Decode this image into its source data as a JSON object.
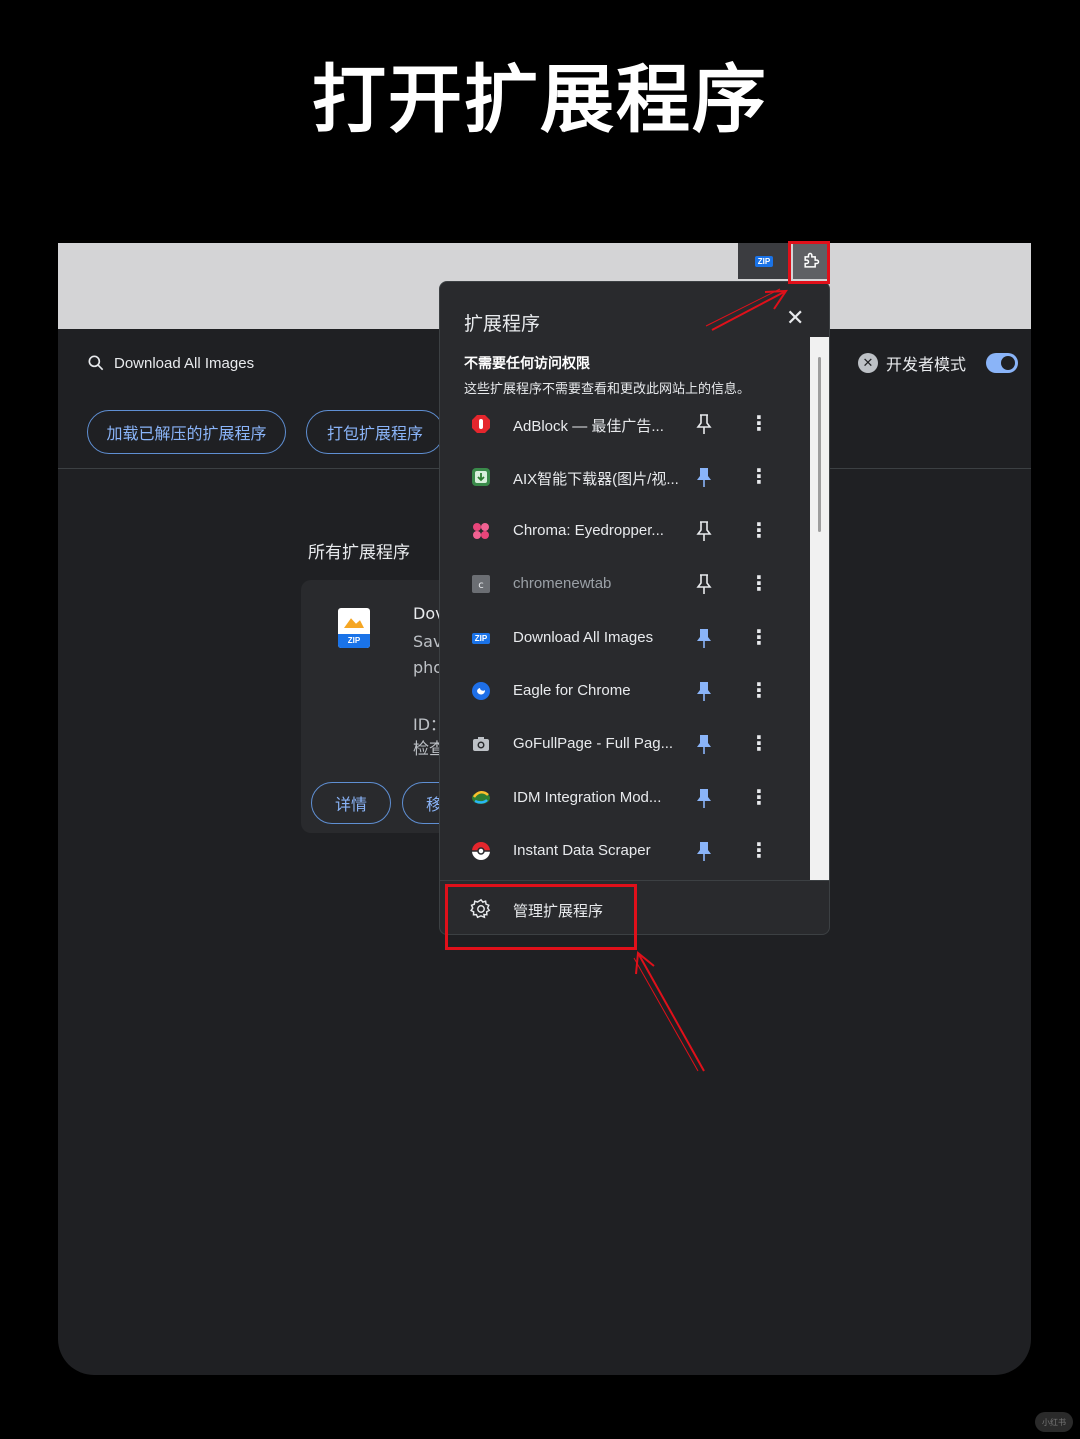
{
  "headline": "打开扩展程序",
  "toolbar": {
    "zip_icon": "zip-icon",
    "puzzle_icon": "puzzle-icon",
    "zip_badge": "ZIP"
  },
  "page": {
    "search_text": "Download All Images",
    "dev_mode_label": "开发者模式",
    "dev_mode_on": true,
    "load_unpacked_label": "加载已解压的扩展程序",
    "pack_label": "打包扩展程序",
    "section_title": "所有扩展程序",
    "card": {
      "name_partial": "Dov",
      "desc_line1_partial": "Sav",
      "desc_line2_partial": "pho",
      "id_partial": "ID：",
      "inspect_partial": "检查",
      "details_label": "详情",
      "remove_partial": "移",
      "zip_label": "ZIP"
    }
  },
  "popup": {
    "title": "扩展程序",
    "close_icon": "close-icon",
    "perm_heading": "不需要任何访问权限",
    "perm_desc": "这些扩展程序不需要查看和更改此网站上的信息。",
    "extensions": [
      {
        "name": "AdBlock — 最佳广告...",
        "icon": "adblock-icon",
        "pinned": false,
        "dim": false
      },
      {
        "name": "AIX智能下载器(图片/视...",
        "icon": "aix-downloader-icon",
        "pinned": true,
        "dim": false
      },
      {
        "name": "Chroma: Eyedropper...",
        "icon": "chroma-icon",
        "pinned": false,
        "dim": false
      },
      {
        "name": "chromenewtab",
        "icon": "chromenewtab-icon",
        "pinned": false,
        "dim": true
      },
      {
        "name": "Download All Images",
        "icon": "zip-icon",
        "pinned": true,
        "dim": false
      },
      {
        "name": "Eagle for Chrome",
        "icon": "eagle-icon",
        "pinned": true,
        "dim": false
      },
      {
        "name": "GoFullPage - Full Pag...",
        "icon": "camera-icon",
        "pinned": true,
        "dim": false
      },
      {
        "name": "IDM Integration Mod...",
        "icon": "idm-icon",
        "pinned": true,
        "dim": false
      },
      {
        "name": "Instant Data Scraper",
        "icon": "pokeball-icon",
        "pinned": true,
        "dim": false
      }
    ],
    "manage_label": "管理扩展程序",
    "manage_icon": "gear-icon"
  },
  "colors": {
    "accent": "#8ab4f8",
    "highlight": "#e0101a",
    "pin_pinned": "#8ab4f8"
  },
  "watermark": "小红书"
}
